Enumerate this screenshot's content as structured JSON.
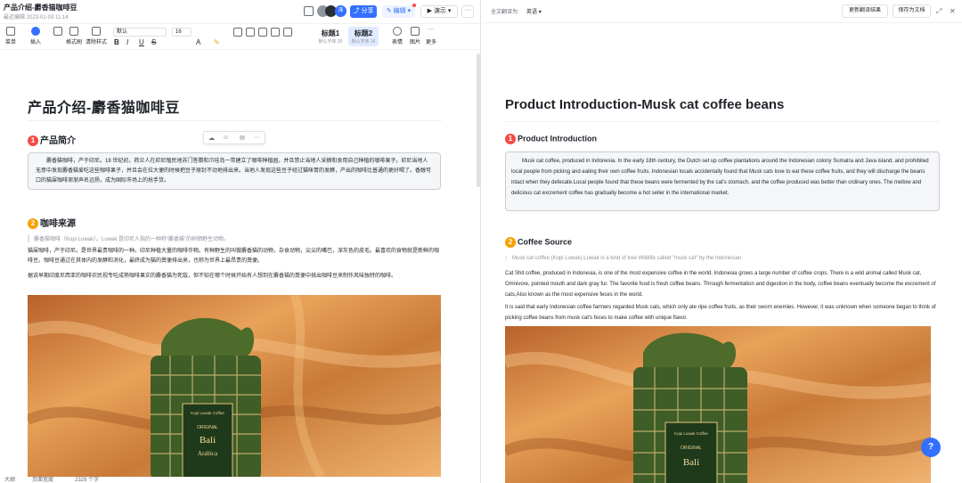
{
  "left": {
    "title": "产品介绍-麝香猫咖啡豆",
    "date": "最近编辑 2023-01-03 11:14",
    "buttons": {
      "share": "分享",
      "edit": "编辑",
      "present": "演示",
      "more": "···"
    },
    "toolbar": {
      "menu": "菜单",
      "insert": "插入",
      "format_painter": "格式刷",
      "clear_format": "清除样式",
      "font_select": "默认",
      "size_select": "16",
      "heading1": "标题1",
      "heading1_sub": "默认字体 20",
      "heading2": "标题2",
      "heading2_sub": "默认字体 16",
      "emoji": "表情",
      "image": "图片",
      "more": "更多",
      "bold": "B",
      "italic": "I",
      "underline": "U",
      "strike": "S"
    },
    "doc": {
      "h1": "产品介绍-麝香猫咖啡豆",
      "section1_num": "1",
      "section1_title": "产品简介",
      "section1_text": "麝香猫咖啡，产于印尼。18 世纪初，荷兰人在印尼殖民地苏门答腊和爪哇岛一带建立了咖啡种植园，并且禁止当地人采摘和食用自己种植的咖啡果子。印尼当地人无意中发现麝香猫爱吃这些咖啡果子，并且会在拉大便的时候把豆子原封不动地排出来。当地人发现这些豆子经过猫咪胃的发酵，产出的咖啡比普通的更好喝了。香醇可口的猫屎咖啡渐渐声名远扬，成为国际市场上的抢手货。",
      "section2_num": "2",
      "section2_title": "咖啡来源",
      "quote": "麝香猫咖啡（Kopi Luwak）。Luwak 是印尼人指的一种称“麝香猫”的树栖野生动物。",
      "para1": "猫屎咖啡，产于印尼。是世界最贵咖啡的一种。印尼种植大量的咖啡作物。有种野生的叫做麝香猫的动物，杂食动物，尖尖的嘴巴，深灰色的皮毛。最喜欢的食物就是新鲜的咖啡豆。咖啡豆通过在其体内的发酵和消化，最终成为猫的粪便排出来，也称为世界上最昂贵的粪便。",
      "para2": "据说早期印度尼西亚的咖啡农民视专吃成熟咖啡果实的麝香猫为死敌，但不知在哪个时候开始有人想到在麝香猫的粪便中挑出咖啡豆来制作风味独特的咖啡。",
      "bag_label1": "Kopi Luwak Coffee",
      "bag_label2": "ORIGINAL",
      "bag_label3": "Bali",
      "bag_label4": "Arabica"
    },
    "status": {
      "outline": "大纲",
      "width": "页面宽度",
      "count": "2329 个字"
    }
  },
  "right": {
    "translate_label": "全文翻译为:",
    "language": "英语",
    "update_button": "更新翻译结果",
    "save_button": "保存为文档",
    "doc": {
      "h1": "Product Introduction-Musk cat coffee beans",
      "section1_num": "1",
      "section1_title": "Product Introduction",
      "section1_text": "Musk cat coffee, produced in Indonesia. In the early 18th century, the Dutch set up coffee plantations around the Indonesian colony Sumatra and Java island, and prohibited local people from picking and eating their own coffee fruits. Indonesian locals accidentally found that Musk cats love to eat these coffee fruits, and they will discharge the beans intact when they defecate.Local people found that these beans were fermented by the cat's stomach, and the coffee produced was better than ordinary ones. The mellow and delicious cat excrement coffee has gradually become a hot seller in the international market.",
      "section2_num": "2",
      "section2_title": "Coffee Source",
      "quote": "Musk cat coffee (Kopi Luwak).Luwak is a kind of tree Wildlife called \"musk cat\" by the Indonesian.",
      "para1": "Cat Shit coffee, produced in Indonesia, is one of the most expensive coffee in the world. Indonesia grows a large number of coffee crops. There is a wild animal called Musk cat, Omnivore, pointed mouth and dark gray fur. The favorite food is fresh coffee beans. Through fermentation and digestion in the body, coffee beans eventually become the excrement of cats,Also known as the most expensive feces in the world.",
      "para2": "It is said that early Indonesian coffee farmers regarded Musk cats, which only ate ripe coffee fruits, as their sworn enemies. However, it was unknown when someone began to think of picking coffee beans from musk cat's feces to make coffee with unique flavor.",
      "bag_label1": "Kopi Luwak Coffee",
      "bag_label2": "ORIGINAL",
      "bag_label3": "Bali"
    }
  },
  "colors": {
    "accent": "#3370ff",
    "red_num": "#f54a45",
    "orange_num": "#f7a000",
    "fabric": "#d98a3a"
  },
  "icons": [
    "star-icon",
    "history-icon",
    "share-icon",
    "edit-icon",
    "play-icon",
    "more-icon",
    "menu-icon",
    "insert-icon",
    "undo-icon",
    "redo-icon",
    "format-painter-icon",
    "eraser-icon",
    "emoji-icon",
    "image-icon",
    "expand-icon",
    "close-icon",
    "help-icon"
  ]
}
